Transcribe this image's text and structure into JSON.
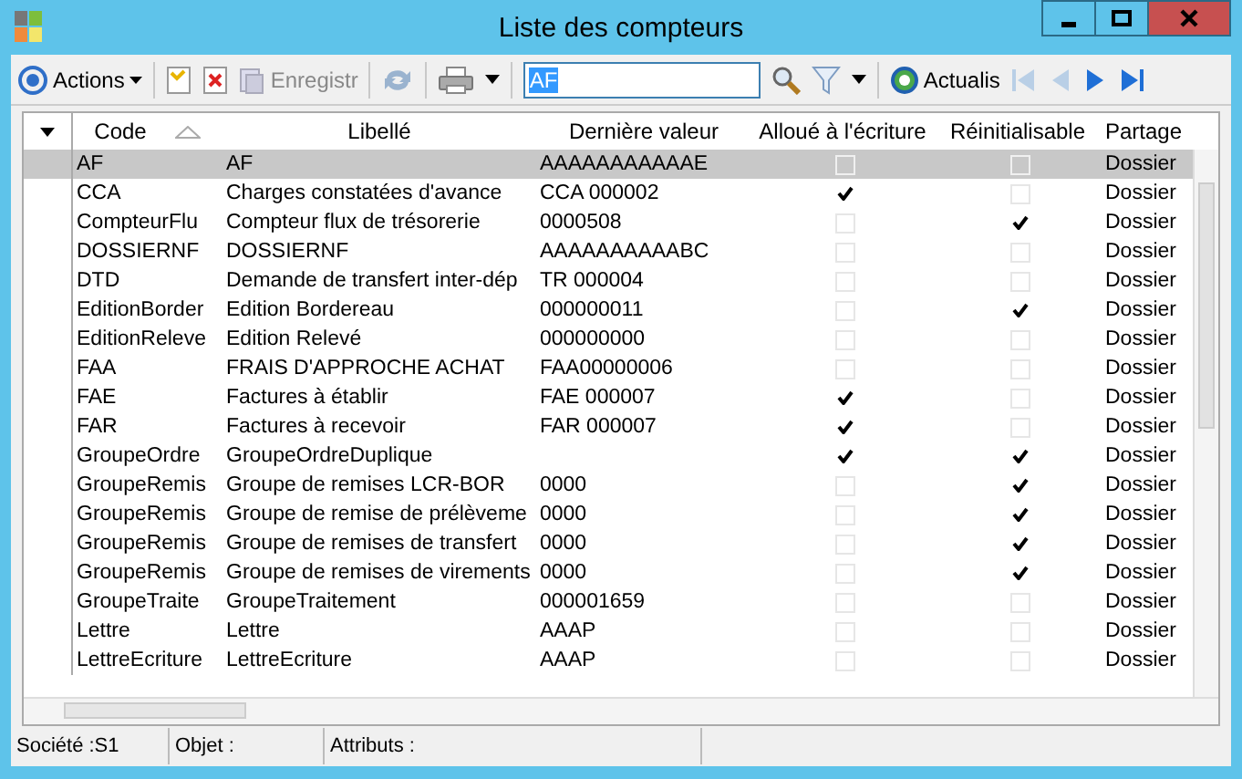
{
  "window": {
    "title": "Liste des compteurs"
  },
  "toolbar": {
    "actions_label": "Actions",
    "save_label": "Enregistr",
    "search_value": "AF",
    "refresh_label": "Actualis"
  },
  "table": {
    "columns": [
      {
        "label": "Code",
        "sorted": true
      },
      {
        "label": "Libellé",
        "sorted": false
      },
      {
        "label": "Dernière valeur",
        "sorted": false
      },
      {
        "label": "Alloué à l'écriture",
        "sorted": false
      },
      {
        "label": "Réinitialisable",
        "sorted": false
      },
      {
        "label": "Partage",
        "sorted": false
      }
    ],
    "rows": [
      {
        "code": "AF",
        "label": "AF",
        "value": "AAAAAAAAAAAE",
        "allocated": false,
        "resettable": false,
        "share": "Dossier",
        "selected": true
      },
      {
        "code": "CCA",
        "label": "Charges constatées d'avance",
        "value": "CCA 000002",
        "allocated": true,
        "resettable": false,
        "share": "Dossier",
        "selected": false
      },
      {
        "code": "CompteurFlu",
        "label": "Compteur flux de trésorerie",
        "value": "0000508",
        "allocated": false,
        "resettable": true,
        "share": "Dossier",
        "selected": false
      },
      {
        "code": "DOSSIERNF",
        "label": "DOSSIERNF",
        "value": "AAAAAAAAAABC",
        "allocated": false,
        "resettable": false,
        "share": "Dossier",
        "selected": false
      },
      {
        "code": "DTD",
        "label": "Demande de transfert inter-dép",
        "value": "TR 000004",
        "allocated": false,
        "resettable": false,
        "share": "Dossier",
        "selected": false
      },
      {
        "code": "EditionBorder",
        "label": "Edition Bordereau",
        "value": "000000011",
        "allocated": false,
        "resettable": true,
        "share": "Dossier",
        "selected": false
      },
      {
        "code": "EditionReleve",
        "label": "Edition Relevé",
        "value": "000000000",
        "allocated": false,
        "resettable": false,
        "share": "Dossier",
        "selected": false
      },
      {
        "code": "FAA",
        "label": "FRAIS D'APPROCHE ACHAT",
        "value": "FAA00000006",
        "allocated": false,
        "resettable": false,
        "share": "Dossier",
        "selected": false
      },
      {
        "code": "FAE",
        "label": "Factures à établir",
        "value": "FAE 000007",
        "allocated": true,
        "resettable": false,
        "share": "Dossier",
        "selected": false
      },
      {
        "code": "FAR",
        "label": "Factures à recevoir",
        "value": "FAR 000007",
        "allocated": true,
        "resettable": false,
        "share": "Dossier",
        "selected": false
      },
      {
        "code": "GroupeOrdre",
        "label": "GroupeOrdreDuplique",
        "value": "",
        "allocated": true,
        "resettable": true,
        "share": "Dossier",
        "selected": false
      },
      {
        "code": "GroupeRemis",
        "label": "Groupe de remises LCR-BOR",
        "value": "0000",
        "allocated": false,
        "resettable": true,
        "share": "Dossier",
        "selected": false
      },
      {
        "code": "GroupeRemis",
        "label": "Groupe de remise de prélèveme",
        "value": "0000",
        "allocated": false,
        "resettable": true,
        "share": "Dossier",
        "selected": false
      },
      {
        "code": "GroupeRemis",
        "label": "Groupe de remises de transfert",
        "value": "0000",
        "allocated": false,
        "resettable": true,
        "share": "Dossier",
        "selected": false
      },
      {
        "code": "GroupeRemis",
        "label": "Groupe de remises de virements",
        "value": "0000",
        "allocated": false,
        "resettable": true,
        "share": "Dossier",
        "selected": false
      },
      {
        "code": "GroupeTraite",
        "label": "GroupeTraitement",
        "value": "000001659",
        "allocated": false,
        "resettable": false,
        "share": "Dossier",
        "selected": false
      },
      {
        "code": "Lettre",
        "label": "Lettre",
        "value": "AAAP",
        "allocated": false,
        "resettable": false,
        "share": "Dossier",
        "selected": false
      },
      {
        "code": "LettreEcriture",
        "label": "LettreEcriture",
        "value": "AAAP",
        "allocated": false,
        "resettable": false,
        "share": "Dossier",
        "selected": false
      }
    ]
  },
  "status_bar": [
    "Société :S1",
    "Objet :",
    "Attributs :"
  ]
}
